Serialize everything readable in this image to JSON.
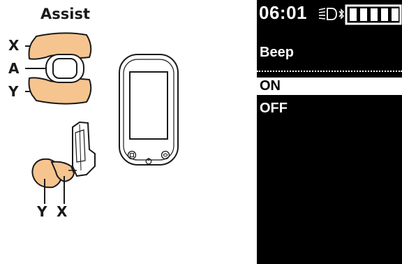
{
  "illustration": {
    "title": "Assist",
    "labels": {
      "x_upper": "X",
      "a": "A",
      "y_upper": "Y",
      "y_lower": "Y",
      "x_lower": "X"
    },
    "accent_color": "#f6c48f"
  },
  "display": {
    "clock": "06:01",
    "status_icons": [
      "light-icon",
      "bluetooth-icon",
      "battery-icon"
    ],
    "battery_bars": 5,
    "title": "Beep",
    "options": [
      {
        "label": "ON",
        "selected": true
      },
      {
        "label": "OFF",
        "selected": false
      }
    ]
  }
}
